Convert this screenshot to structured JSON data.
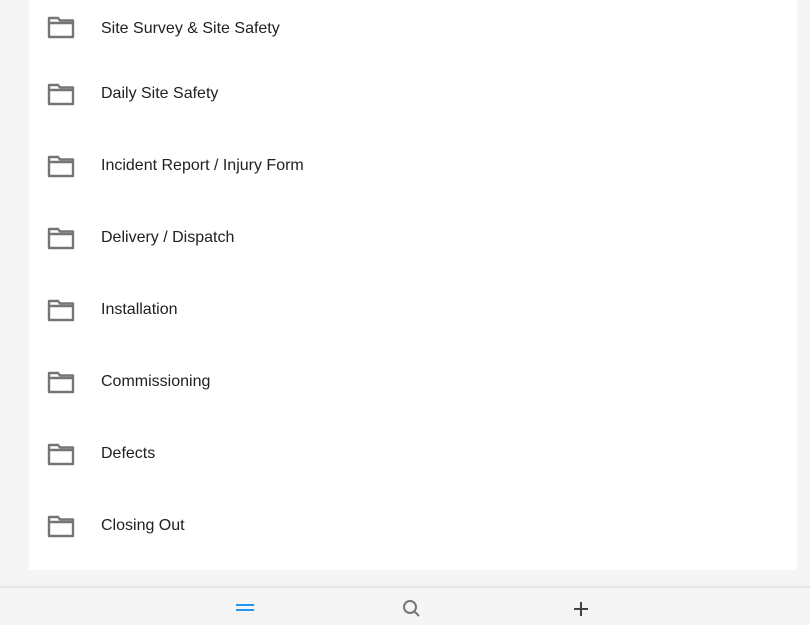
{
  "folders": [
    {
      "label": "Site Survey & Site Safety",
      "icon": "folder-icon"
    },
    {
      "label": "Daily Site Safety",
      "icon": "folder-icon"
    },
    {
      "label": "Incident Report / Injury Form",
      "icon": "folder-icon"
    },
    {
      "label": "Delivery / Dispatch",
      "icon": "folder-icon"
    },
    {
      "label": "Installation",
      "icon": "folder-icon"
    },
    {
      "label": "Commissioning",
      "icon": "folder-icon"
    },
    {
      "label": "Defects",
      "icon": "folder-icon"
    },
    {
      "label": "Closing Out",
      "icon": "folder-icon"
    }
  ],
  "bottom_nav": {
    "items": [
      {
        "name": "menu",
        "icon": "menu-icon",
        "active": true
      },
      {
        "name": "search",
        "icon": "search-icon",
        "active": false
      },
      {
        "name": "add",
        "icon": "plus-icon",
        "active": false
      }
    ]
  },
  "colors": {
    "background": "#f5f5f5",
    "card": "#ffffff",
    "text": "#212121",
    "icon": "#757575",
    "accent": "#2196f3"
  }
}
